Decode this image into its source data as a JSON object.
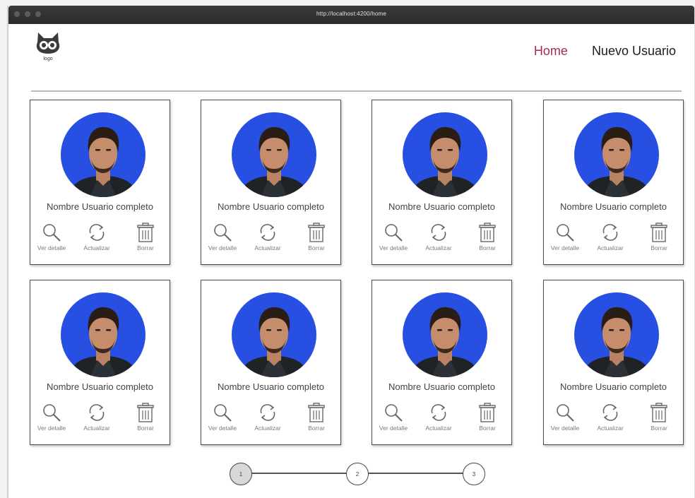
{
  "browser": {
    "url": "http://localhost:4200/home"
  },
  "header": {
    "logo_text": "logo",
    "nav": {
      "home": "Home",
      "nuevo": "Nuevo Usuario"
    }
  },
  "colors": {
    "accent": "#a0304e",
    "avatar_bg": "#2750e3"
  },
  "cards": [
    {
      "name": "Nombre Usuario completo",
      "view": "Ver detalle",
      "update": "Actualizar",
      "delete": "Borrar"
    },
    {
      "name": "Nombre Usuario completo",
      "view": "Ver detalle",
      "update": "Actualizar",
      "delete": "Borrar"
    },
    {
      "name": "Nombre Usuario completo",
      "view": "Ver detalle",
      "update": "Actualizar",
      "delete": "Borrar"
    },
    {
      "name": "Nombre Usuario completo",
      "view": "Ver detalle",
      "update": "Actualizar",
      "delete": "Borrar"
    },
    {
      "name": "Nombre Usuario completo",
      "view": "Ver detalle",
      "update": "Actualizar",
      "delete": "Borrar"
    },
    {
      "name": "Nombre Usuario completo",
      "view": "Ver detalle",
      "update": "Actualizar",
      "delete": "Borrar"
    },
    {
      "name": "Nombre Usuario completo",
      "view": "Ver detalle",
      "update": "Actualizar",
      "delete": "Borrar"
    },
    {
      "name": "Nombre Usuario completo",
      "view": "Ver detalle",
      "update": "Actualizar",
      "delete": "Borrar"
    }
  ],
  "pagination": {
    "pages": [
      "1",
      "2",
      "3"
    ],
    "current": "1"
  }
}
